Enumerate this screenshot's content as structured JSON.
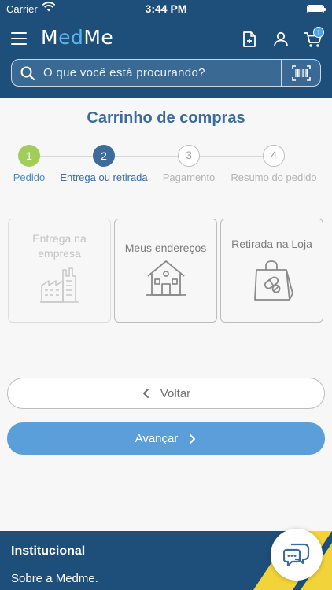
{
  "status_bar": {
    "carrier": "Carrier",
    "time": "3:44 PM"
  },
  "header": {
    "logo_prefix": "M",
    "logo_accent": "ed",
    "logo_suffix": "Me",
    "cart_count": "1",
    "icons": [
      "menu-icon",
      "prescription-icon",
      "user-icon",
      "cart-icon"
    ]
  },
  "search": {
    "placeholder": "O que você está procurando?",
    "value": ""
  },
  "page": {
    "title": "Carrinho de compras"
  },
  "steps": [
    {
      "number": "1",
      "label": "Pedido",
      "state": "done"
    },
    {
      "number": "2",
      "label": "Entrega ou retirada",
      "state": "active"
    },
    {
      "number": "3",
      "label": "Pagamento",
      "state": "todo"
    },
    {
      "number": "4",
      "label": "Resumo do pedido",
      "state": "todo"
    }
  ],
  "delivery_options": [
    {
      "label": "Entrega na empresa",
      "icon": "factory-icon",
      "enabled": false
    },
    {
      "label": "Meus endereços",
      "icon": "house-icon",
      "enabled": true
    },
    {
      "label": "Retirada na Loja",
      "icon": "pharmacy-bag-icon",
      "enabled": true
    }
  ],
  "actions": {
    "back_label": "Voltar",
    "next_label": "Avançar"
  },
  "footer": {
    "title": "Institucional",
    "link": "Sobre a Medme."
  },
  "colors": {
    "primary": "#1e4f7a",
    "accent": "#5a9fd9",
    "step_done": "#a3cd5a",
    "stripe": "#f2d43a"
  }
}
